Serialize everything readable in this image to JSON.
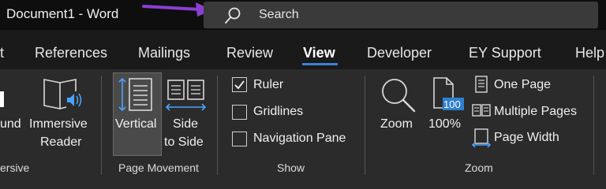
{
  "titlebar": {
    "doc_title": "Document1  -  Word",
    "search": "Search"
  },
  "tabs": [
    {
      "label": "t"
    },
    {
      "label": "References"
    },
    {
      "label": "Mailings"
    },
    {
      "label": "Review"
    },
    {
      "label": "View",
      "active": true
    },
    {
      "label": "Developer"
    },
    {
      "label": "EY Support"
    },
    {
      "label": "Help"
    }
  ],
  "ribbon": {
    "immersive": {
      "partial_label": "und",
      "immersive_reader_line1": "Immersive",
      "immersive_reader_line2": "Reader",
      "group_label": "ersive"
    },
    "page_movement": {
      "vertical": "Vertical",
      "side_line1": "Side",
      "side_line2": "to Side",
      "group_label": "Page Movement"
    },
    "show": {
      "ruler": "Ruler",
      "ruler_checked": true,
      "gridlines": "Gridlines",
      "gridlines_checked": false,
      "navigation_pane": "Navigation Pane",
      "navigation_pane_checked": false,
      "group_label": "Show"
    },
    "zoom": {
      "zoom": "Zoom",
      "hundred_percent": "100%",
      "hundred_badge": "100",
      "one_page": "One Page",
      "multiple_pages": "Multiple Pages",
      "page_width": "Page Width",
      "group_label": "Zoom"
    }
  },
  "colors": {
    "accent_blue": "#3f7fd6",
    "annotation_arrow": "#8a3fd1",
    "titlebar_bg": "#0e0e0e",
    "ribbon_bg": "#2b2b2b"
  }
}
